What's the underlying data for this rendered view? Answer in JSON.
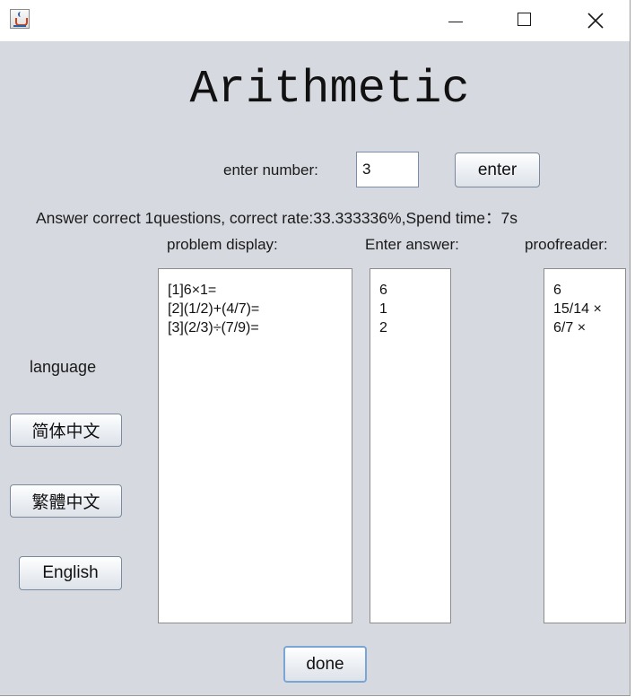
{
  "app": {
    "title": "Arithmetic"
  },
  "controls": {
    "enter_number_label": "enter number:",
    "number_value": "3",
    "enter_button": "enter",
    "done_button": "done"
  },
  "result": {
    "summary": "Answer correct 1questions, correct rate:33.333336%,Spend time：7s"
  },
  "columns": {
    "problem_header": "problem display:",
    "answer_header": "Enter answer:",
    "proof_header": "proofreader:"
  },
  "problems": [
    "[1]6×1=",
    "[2](1/2)+(4/7)=",
    "[3](2/3)÷(7/9)="
  ],
  "answers": [
    "6",
    "1",
    "2"
  ],
  "proofreads": [
    "6",
    "15/14 ×",
    "6/7 ×"
  ],
  "language": {
    "label": "language",
    "simplified": "简体中文",
    "traditional": "繁體中文",
    "english": "English"
  }
}
